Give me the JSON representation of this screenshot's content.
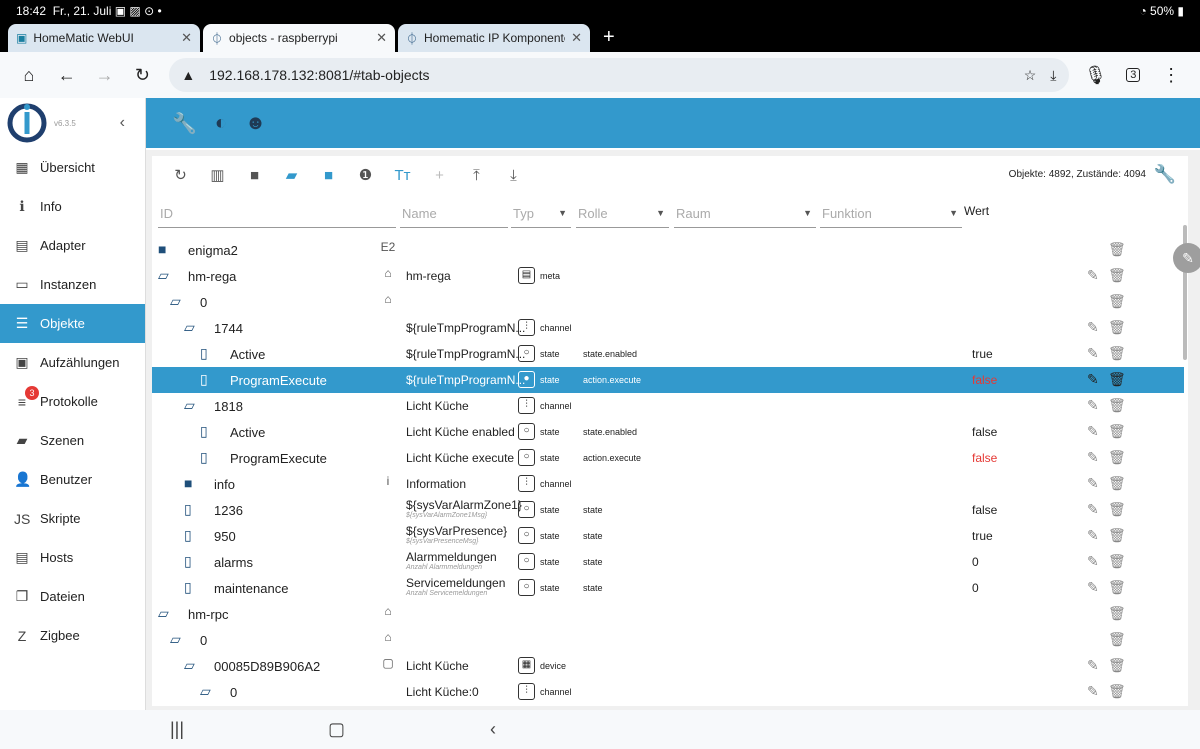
{
  "status": {
    "time": "18:42",
    "date": "Fr., 21. Juli",
    "battery": "50%"
  },
  "tabs": [
    {
      "title": "HomeMatic WebUI"
    },
    {
      "title": "objects - raspberrypi"
    },
    {
      "title": "Homematic IP Komponenten"
    }
  ],
  "browser": {
    "url": "192.168.178.132:8081/#tab-objects",
    "tab_count": "3"
  },
  "sidebar": {
    "version": "v6.3.5",
    "items": [
      {
        "label": "Übersicht",
        "icon": "grid-icon",
        "glyph": "▦"
      },
      {
        "label": "Info",
        "icon": "info-icon",
        "glyph": "ℹ"
      },
      {
        "label": "Adapter",
        "icon": "store-icon",
        "glyph": "▤"
      },
      {
        "label": "Instanzen",
        "icon": "instances-icon",
        "glyph": "▭"
      },
      {
        "label": "Objekte",
        "icon": "list-icon",
        "glyph": "☰"
      },
      {
        "label": "Aufzählungen",
        "icon": "enum-icon",
        "glyph": "▣"
      },
      {
        "label": "Protokolle",
        "icon": "log-icon",
        "glyph": "≡",
        "badge": "3"
      },
      {
        "label": "Szenen",
        "icon": "scene-icon",
        "glyph": "▰"
      },
      {
        "label": "Benutzer",
        "icon": "user-icon",
        "glyph": "👤"
      },
      {
        "label": "Skripte",
        "icon": "js-icon",
        "glyph": "JS"
      },
      {
        "label": "Hosts",
        "icon": "hosts-icon",
        "glyph": "▤"
      },
      {
        "label": "Dateien",
        "icon": "files-icon",
        "glyph": "❐"
      },
      {
        "label": "Zigbee",
        "icon": "zigbee-icon",
        "glyph": "Z"
      }
    ]
  },
  "objects": {
    "counts": "Objekte: 4892, Zustände: 4094",
    "filters": {
      "id": "ID",
      "name": "Name",
      "typ": "Typ",
      "rolle": "Rolle",
      "raum": "Raum",
      "funktion": "Funktion",
      "wert": "Wert"
    },
    "rows": [
      {
        "lvl": 0,
        "kind": "folder",
        "id": "enigma2",
        "nicon": "E2"
      },
      {
        "lvl": 0,
        "kind": "open",
        "id": "hm-rega",
        "nicon": "⌂",
        "name": "hm-rega",
        "tglyph": "▤",
        "typ": "meta",
        "edit": true
      },
      {
        "lvl": 1,
        "kind": "open",
        "id": "0",
        "nicon": "⌂"
      },
      {
        "lvl": 2,
        "kind": "open",
        "id": "1744",
        "name": "${ruleTmpProgramN...",
        "tglyph": "⫶",
        "typ": "channel",
        "edit": true
      },
      {
        "lvl": 3,
        "kind": "file",
        "id": "Active",
        "name": "${ruleTmpProgramN...",
        "tglyph": "○",
        "typ": "state",
        "rolle": "state.enabled",
        "wert": "true",
        "edit": true
      },
      {
        "lvl": 3,
        "kind": "file",
        "id": "ProgramExecute",
        "name": "${ruleTmpProgramN...",
        "tglyph": "●",
        "typ": "state",
        "rolle": "action.execute",
        "wert": "false",
        "red": true,
        "edit": true,
        "sel": true
      },
      {
        "lvl": 2,
        "kind": "open",
        "id": "1818",
        "name": "Licht Küche",
        "tglyph": "⫶",
        "typ": "channel",
        "edit": true
      },
      {
        "lvl": 3,
        "kind": "file",
        "id": "Active",
        "name": "Licht Küche enabled",
        "tglyph": "○",
        "typ": "state",
        "rolle": "state.enabled",
        "wert": "false",
        "edit": true
      },
      {
        "lvl": 3,
        "kind": "file",
        "id": "ProgramExecute",
        "name": "Licht Küche execute",
        "tglyph": "○",
        "typ": "state",
        "rolle": "action.execute",
        "wert": "false",
        "red": true,
        "edit": true
      },
      {
        "lvl": 2,
        "kind": "folder",
        "id": "info",
        "nicon": "i",
        "name": "Information",
        "tglyph": "⫶",
        "typ": "channel",
        "edit": true
      },
      {
        "lvl": 2,
        "kind": "file",
        "id": "1236",
        "name": "${sysVarAlarmZone1}",
        "sub": "${sysVarAlarmZone1Msg}",
        "tglyph": "○",
        "typ": "state",
        "rolle": "state",
        "wert": "false",
        "edit": true
      },
      {
        "lvl": 2,
        "kind": "file",
        "id": "950",
        "name": "${sysVarPresence}",
        "sub": "${sysVarPresenceMsg}",
        "tglyph": "○",
        "typ": "state",
        "rolle": "state",
        "wert": "true",
        "edit": true
      },
      {
        "lvl": 2,
        "kind": "file",
        "id": "alarms",
        "name": "Alarmmeldungen",
        "sub": "Anzahl Alarmmeldungen",
        "tglyph": "○",
        "typ": "state",
        "rolle": "state",
        "wert": "0",
        "edit": true
      },
      {
        "lvl": 2,
        "kind": "file",
        "id": "maintenance",
        "name": "Servicemeldungen",
        "sub": "Anzahl Servicemeldungen",
        "tglyph": "○",
        "typ": "state",
        "rolle": "state",
        "wert": "0",
        "edit": true
      },
      {
        "lvl": 0,
        "kind": "open",
        "id": "hm-rpc",
        "nicon": "⌂"
      },
      {
        "lvl": 1,
        "kind": "open",
        "id": "0",
        "nicon": "⌂"
      },
      {
        "lvl": 2,
        "kind": "open",
        "id": "00085D89B906A2",
        "nicon": "▢",
        "name": "Licht Küche",
        "tglyph": "▦",
        "typ": "device",
        "edit": true
      },
      {
        "lvl": 3,
        "kind": "open",
        "id": "0",
        "name": "Licht Küche:0",
        "tglyph": "⫶",
        "typ": "channel",
        "edit": true
      }
    ]
  },
  "colors": {
    "accent": "#3399cc",
    "false_value": "#e53935",
    "folder": "#1f4f7a"
  }
}
